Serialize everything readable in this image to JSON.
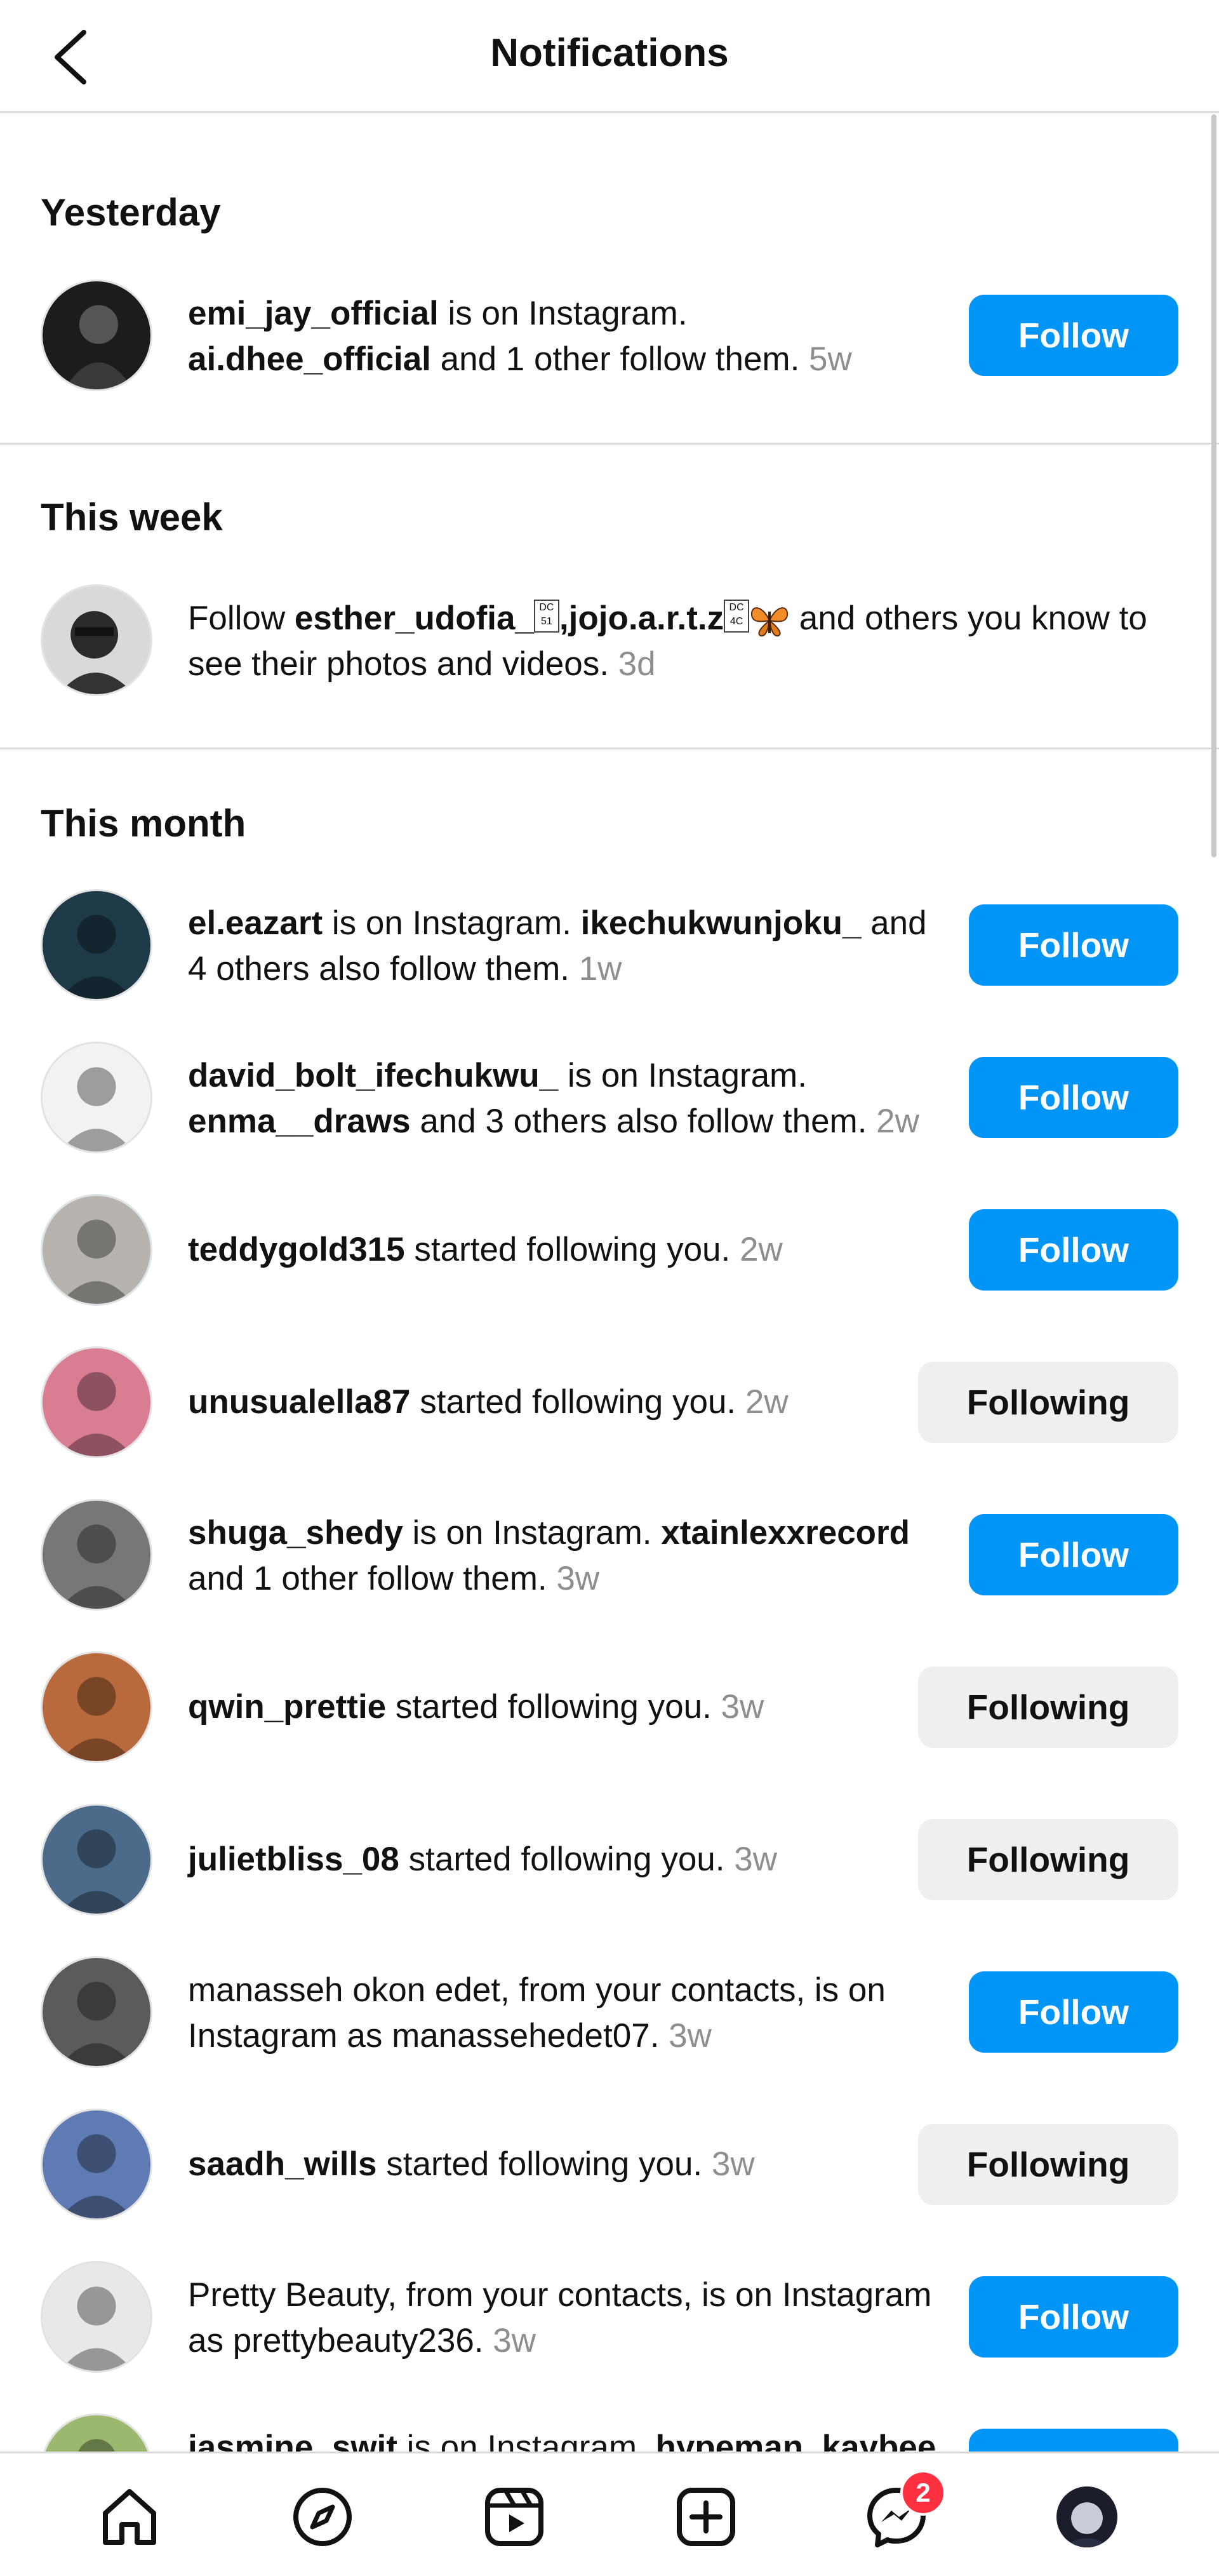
{
  "header": {
    "title": "Notifications",
    "back_icon": "chevron-left-icon"
  },
  "sections": {
    "yesterday": "Yesterday",
    "this_week": "This week",
    "this_month": "This month"
  },
  "yesterday": {
    "user": "emi_jay_official",
    "text1": " is on Instagram.",
    "user2": "ai.dhee_official",
    "text2": " and 1 other follow them. ",
    "time": "5w",
    "button": "Follow"
  },
  "this_week": {
    "prefix": "Follow ",
    "user1": "esther_udofia_",
    "glyph1": "DC 51",
    "sep": ",",
    "user2": "jojo.a.r.t.z",
    "glyph2": "DC 4C",
    "suffix": " and others you know to see their photos and videos. ",
    "time": "3d"
  },
  "month": [
    {
      "user": "el.eazart",
      "text1": " is on Instagram. ",
      "user2": "ikechukwunjoku_",
      "text2": " and 4 others also follow them. ",
      "time": "1w",
      "button": "Follow"
    },
    {
      "user": "david_bolt_ifechukwu_",
      "text1": " is on Instagram. ",
      "user2": "enma__draws",
      "text2": " and 3 others also follow them. ",
      "time": "2w",
      "button": "Follow"
    },
    {
      "user": "teddygold315",
      "text1": " started following you. ",
      "user2": "",
      "text2": "",
      "time": "2w",
      "button": "Follow"
    },
    {
      "user": "unusualella87",
      "text1": " started following you. ",
      "user2": "",
      "text2": "",
      "time": "2w",
      "button": "Following"
    },
    {
      "user": "shuga_shedy",
      "text1": " is on Instagram. ",
      "user2": "xtainlexxrecord",
      "text2": " and 1 other follow them. ",
      "time": "3w",
      "button": "Follow"
    },
    {
      "user": "qwin_prettie",
      "text1": " started following you. ",
      "user2": "",
      "text2": "",
      "time": "3w",
      "button": "Following"
    },
    {
      "user": "julietbliss_08",
      "text1": " started following you. ",
      "user2": "",
      "text2": "",
      "time": "3w",
      "button": "Following"
    },
    {
      "user": "",
      "text1": "manasseh okon edet, from your contacts, is on Instagram as manassehedet07. ",
      "user2": "",
      "text2": "",
      "time": "3w",
      "button": "Follow"
    },
    {
      "user": "saadh_wills",
      "text1": " started following you. ",
      "user2": "",
      "text2": "",
      "time": "3w",
      "button": "Following"
    },
    {
      "user": "",
      "text1": "Pretty Beauty, from your contacts, is on Instagram as prettybeauty236. ",
      "user2": "",
      "text2": "",
      "time": "3w",
      "button": "Follow"
    },
    {
      "user": "jasmine_swit",
      "text1": " is on Instagram. ",
      "user2": "hypeman_kaybee",
      "text2": "",
      "time": "",
      "button": "Follow"
    }
  ],
  "nav": {
    "items": [
      "home-icon",
      "explore-icon",
      "reels-icon",
      "create-icon",
      "messenger-icon",
      "profile-avatar"
    ],
    "messenger_badge": "2"
  },
  "colors": {
    "follow_blue": "#0095f6",
    "following_gray": "#efefef",
    "badge_red": "#ff3040",
    "time_gray": "#8e8e8e"
  }
}
